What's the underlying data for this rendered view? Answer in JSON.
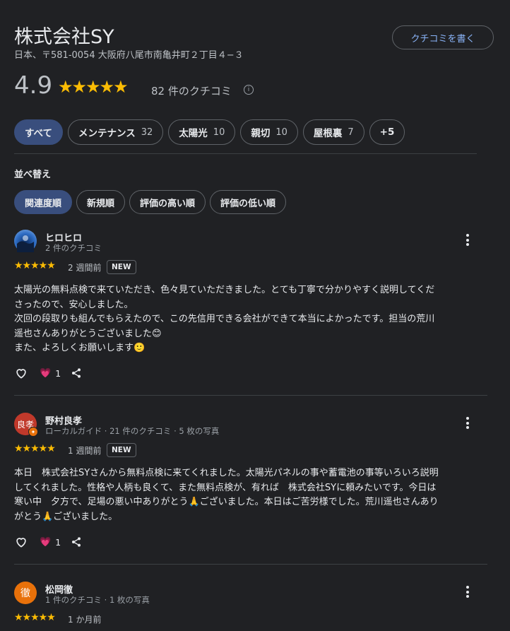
{
  "business": {
    "name": "株式会社SY",
    "address": "日本、〒581-0054 大阪府八尾市南亀井町２丁目４−３",
    "write_review_label": "クチコミを書く",
    "rating": "4.9",
    "stars": "★★★★★",
    "review_count": "82 件のクチコミ",
    "info_icon_glyph": "i"
  },
  "filters": [
    {
      "label": "すべて",
      "count": "",
      "selected": true
    },
    {
      "label": "メンテナンス",
      "count": "32"
    },
    {
      "label": "太陽光",
      "count": "10"
    },
    {
      "label": "親切",
      "count": "10"
    },
    {
      "label": "屋根裏",
      "count": "7"
    },
    {
      "label": "+5",
      "count": ""
    }
  ],
  "sort": {
    "label": "並べ替え",
    "options": [
      "関連度順",
      "新規順",
      "評価の高い順",
      "評価の低い順"
    ],
    "selected": "関連度順"
  },
  "reviews": [
    {
      "name": "ヒロヒロ",
      "meta": "2 件のクチコミ",
      "stars": "★★★★★",
      "date": "2 週間前",
      "badge": "NEW",
      "lines": [
        "太陽光の無料点検で来ていただき、色々見ていただきました。とても丁寧で分かりやすく説明してくだ",
        "さったので、安心しました。",
        "次回の段取りも組んでもらえたので、この先信用できる会社ができて本当によかったです。担当の荒川",
        "遥也さんありがとうございました😊",
        "また、よろしくお願いします🙂"
      ],
      "reaction_count": "1",
      "avatar_color": "#1e5aa8",
      "avatar_text": ""
    },
    {
      "name": "野村良孝",
      "meta": "ローカルガイド · 21 件のクチコミ · 5 枚の写真",
      "stars": "★★★★★",
      "date": "1 週間前",
      "badge": "NEW",
      "lines": [
        "本日　株式会社SYさんから無料点検に来てくれました。太陽光パネルの事や蓄電池の事等いろいろ説明",
        "してくれました。性格や人柄も良くて、また無料点検が、有れば　株式会社SYに頼みたいです。今日は",
        "寒い中　夕方で、足場の悪い中ありがとう🙏ございました。本日はご苦労様でした。荒川遥也さんあり",
        "がとう🙏ございました。"
      ],
      "reaction_count": "1",
      "avatar_color": "#c0392b",
      "avatar_text": "良孝"
    },
    {
      "name": "松岡徹",
      "meta": "1 件のクチコミ · 1 枚の写真",
      "stars": "★★★★★",
      "date": "1 か月前",
      "badge": "",
      "lines": [],
      "reaction_count": "",
      "avatar_color": "#e8710a",
      "avatar_text": "徹"
    }
  ]
}
